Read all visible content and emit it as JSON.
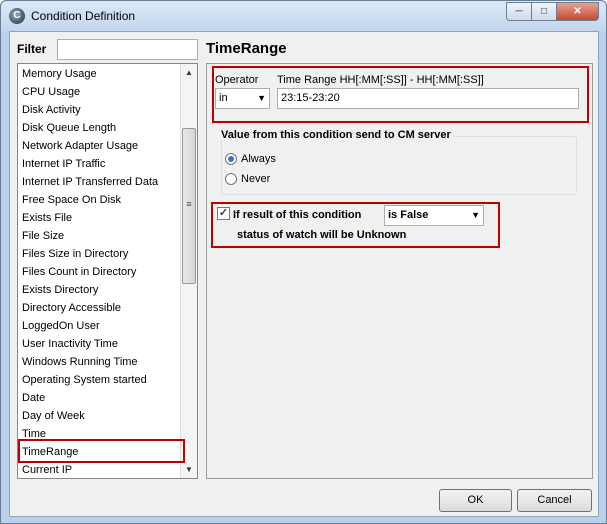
{
  "window": {
    "title": "Condition Definition",
    "icon": "C"
  },
  "filter": {
    "label": "Filter",
    "value": ""
  },
  "conditions": [
    "Memory Usage",
    "CPU Usage",
    "Disk Activity",
    "Disk Queue Length",
    "Network Adapter Usage",
    "Internet IP Traffic",
    "Internet IP Transferred Data",
    "Free Space On Disk",
    "Exists File",
    "File Size",
    "Files Size in Directory",
    "Files Count in Directory",
    "Exists Directory",
    "Directory Accessible",
    "LoggedOn User",
    "User Inactivity Time",
    "Windows Running Time",
    "Operating System started",
    "Date",
    "Day of Week",
    "Time",
    "TimeRange",
    "Current IP"
  ],
  "selected_condition": "TimeRange",
  "detail": {
    "title": "TimeRange",
    "operator_label": "Operator",
    "operator_value": "in",
    "range_label": "Time Range HH[:MM[:SS]] - HH[:MM[:SS]]",
    "range_value": "23:15-23:20",
    "send_group_title": "Value from this condition send to CM server",
    "send_always": "Always",
    "send_never": "Never",
    "result_label": "If result of this condition",
    "result_value": "is False",
    "status_text": "status of watch will be Unknown"
  },
  "buttons": {
    "ok": "OK",
    "cancel": "Cancel"
  }
}
